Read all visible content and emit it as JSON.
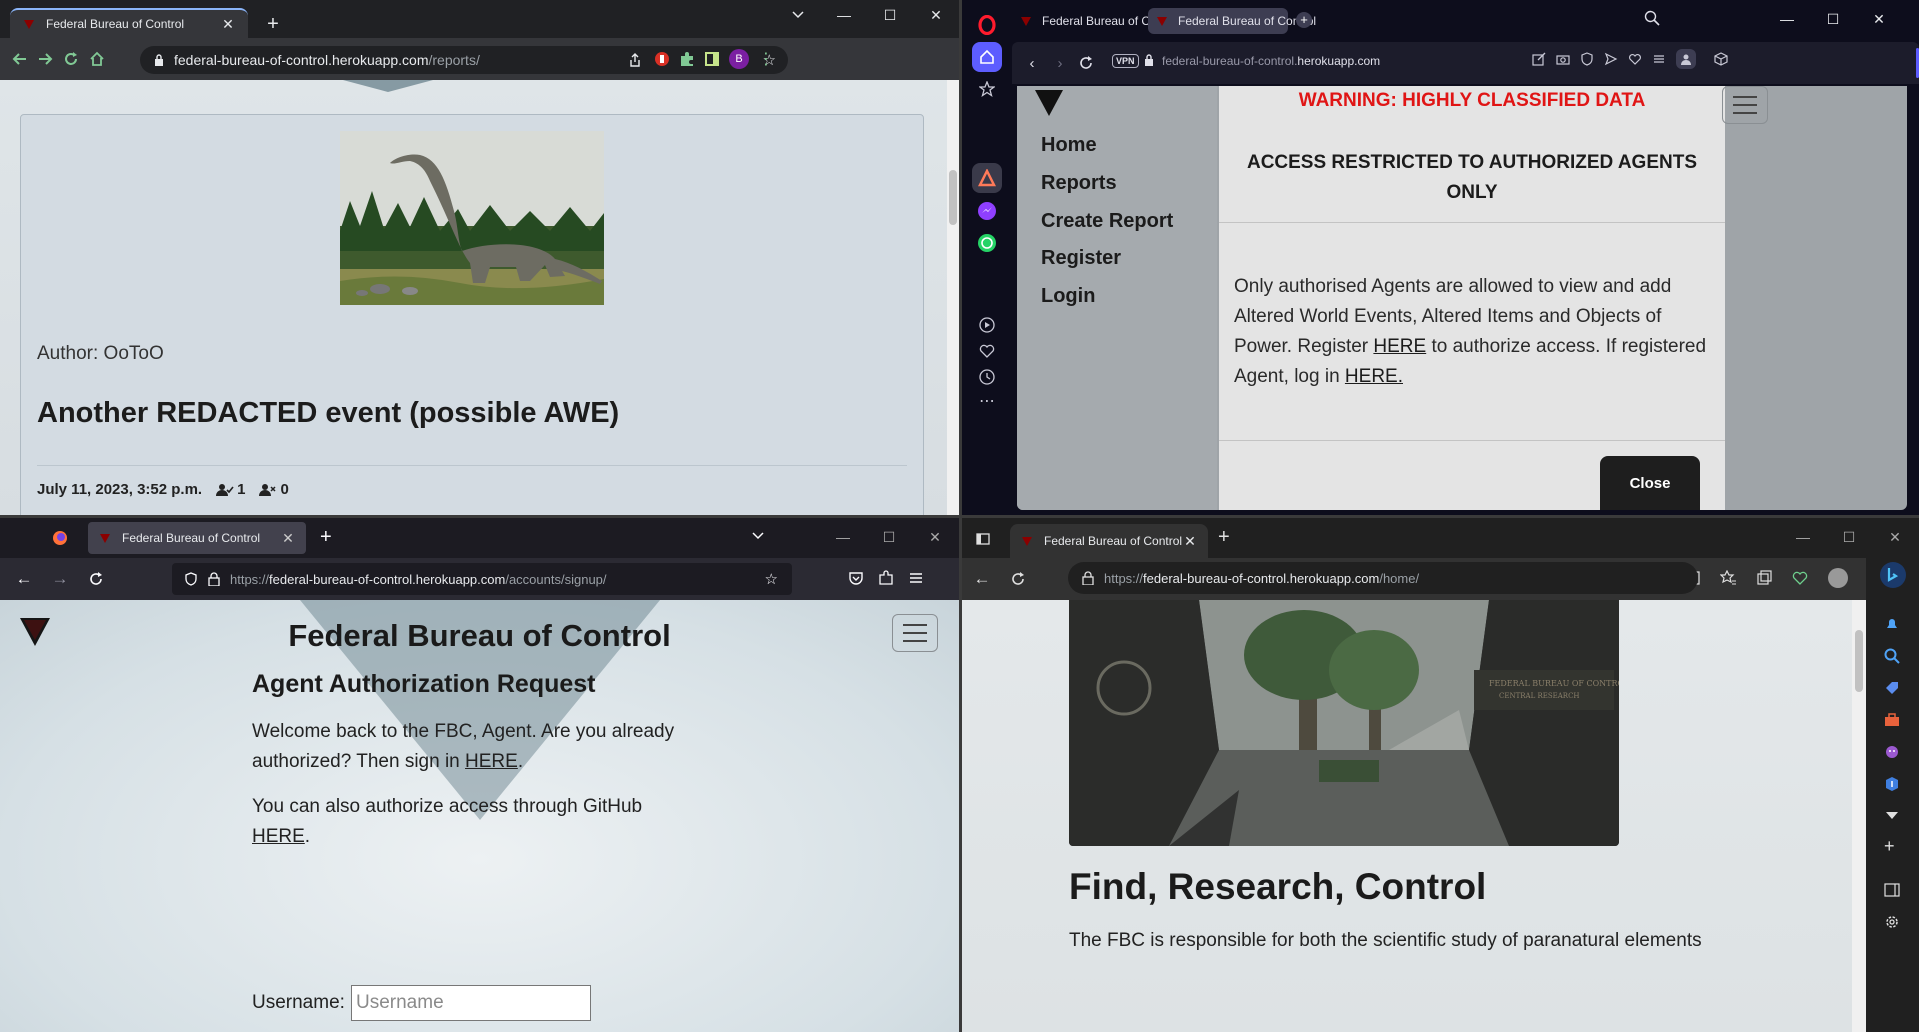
{
  "chrome": {
    "tab_title": "Federal Bureau of Control",
    "url_host": "federal-bureau-of-control.herokuapp.com",
    "url_path": "/reports/",
    "profile_initial": "B",
    "report": {
      "author": "Author: OoToO",
      "title": "Another REDACTED event (possible AWE)",
      "date": "July 11, 2023, 3:52 p.m.",
      "agree_count": "1",
      "disagree_count": "0"
    }
  },
  "opera": {
    "tabs": [
      "Federal Bureau of Control",
      "Federal Bureau of Control"
    ],
    "vpn_label": "VPN",
    "url_prefix": "federal-bureau-of-control.",
    "url_domain": "herokuapp.com",
    "nav": [
      "Home",
      "Reports",
      "Create Report",
      "Register",
      "Login"
    ],
    "modal": {
      "warning": "WARNING: HIGHLY CLASSIFIED DATA",
      "heading": "ACCESS RESTRICTED TO AUTHORIZED AGENTS ONLY",
      "body_1": "Only authorised Agents are allowed to view and add Altered World Events, Altered Items and Objects of Power. Register ",
      "link_here_1": "HERE",
      "body_2": " to authorize access. If registered Agent, log in ",
      "link_here_2": "HERE.",
      "close": "Close"
    }
  },
  "firefox": {
    "tab_title": "Federal Bureau of Control",
    "url_scheme": "https://",
    "url_host": "federal-bureau-of-control.herokuapp.com",
    "url_path": "/accounts/signup/",
    "site_title": "Federal Bureau of Control",
    "heading": "Agent Authorization Request",
    "welcome_1": "Welcome back to the FBC, Agent. Are you already",
    "welcome_2": "authorized? Then sign in ",
    "here_1": "HERE",
    "github_1": "You can also authorize access through GitHub",
    "here_2": "HERE",
    "username_label": "Username:",
    "username_placeholder": "Username"
  },
  "edge": {
    "tab_title": "Federal Bureau of Control",
    "url_scheme": "https://",
    "url_host": "federal-bureau-of-control.herokuapp.com",
    "url_path": "/home/",
    "heading": "Find, Research, Control",
    "intro": "The FBC is responsible for both the scientific study of paranatural elements"
  },
  "colors": {
    "chrome_accent": "#8ab4f8",
    "opera_accent": "#5d5dff",
    "warning_red": "#e01515",
    "fbc_red": "#8b0000"
  }
}
